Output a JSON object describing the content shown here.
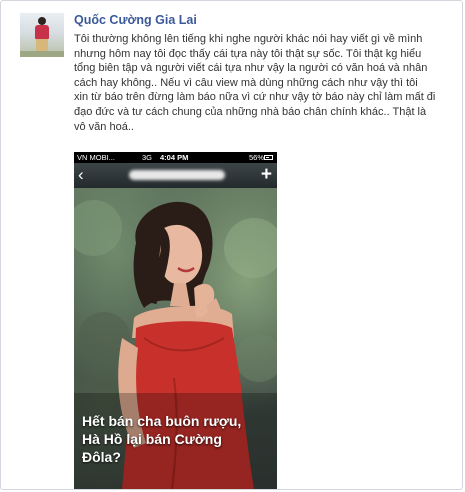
{
  "post": {
    "author": "Quốc Cường Gia Lai",
    "text": "Tôi thường không lên tiếng khi nghe người khác nói hay viết gì về mình\nnhưng hôm nay tôi đọc thấy cái tựa này tôi thật sự sốc. Tôi thật kg hiểu\ntổng biên tập và người viết cái tựa như vậy la người có văn hoá và nhân\ncách hay không.. Nếu vì câu view mà dùng những cách như vậy thì tôi\nxin từ báo trên đừng làm báo nữa vì cứ như vậy tờ báo này chỉ làm mất đi\nđạo đức và tư cách chung của những nhà báo chân chính khác.. Thật là\nvô văn hoá.."
  },
  "phone": {
    "status": {
      "carrier": "VN MOBI...",
      "network": "3G",
      "time": "4:04 PM",
      "battery": "56%"
    },
    "nav": {
      "back_icon": "chevron-left-icon",
      "add_icon": "plus-icon"
    },
    "headline": "Hết bán cha buôn rượu,\nHà Hồ lại bán Cường\nĐôla?"
  },
  "colors": {
    "author": "#3b5998",
    "dress": "#c8312b"
  }
}
